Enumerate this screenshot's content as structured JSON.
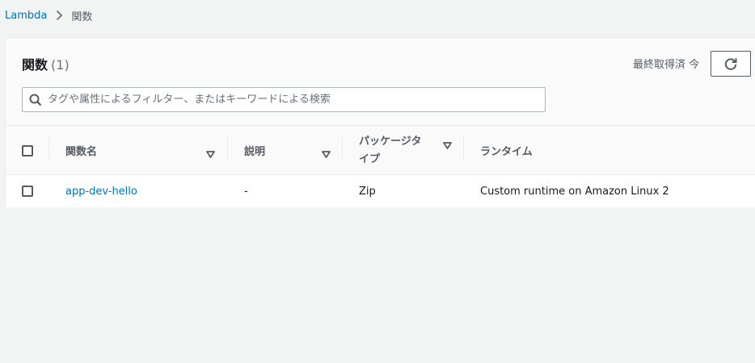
{
  "breadcrumb": {
    "root": "Lambda",
    "current": "関数"
  },
  "panel": {
    "title": "関数",
    "count": "(1)",
    "last_fetched": "最終取得済 今",
    "refresh_icon": "refresh-icon"
  },
  "filter": {
    "placeholder": "タグや属性によるフィルター、またはキーワードによる検索",
    "value": ""
  },
  "table": {
    "columns": [
      {
        "label": "関数名"
      },
      {
        "label": "説明"
      },
      {
        "label": "パッケージタイプ"
      },
      {
        "label": "ランタイム"
      }
    ],
    "rows": [
      {
        "name": "app-dev-hello",
        "description": "-",
        "package_type": "Zip",
        "runtime": "Custom runtime on Amazon Linux 2"
      }
    ]
  },
  "colors": {
    "link": "#0073bb",
    "background": "#f2f3f3",
    "header_text": "#545b64"
  }
}
